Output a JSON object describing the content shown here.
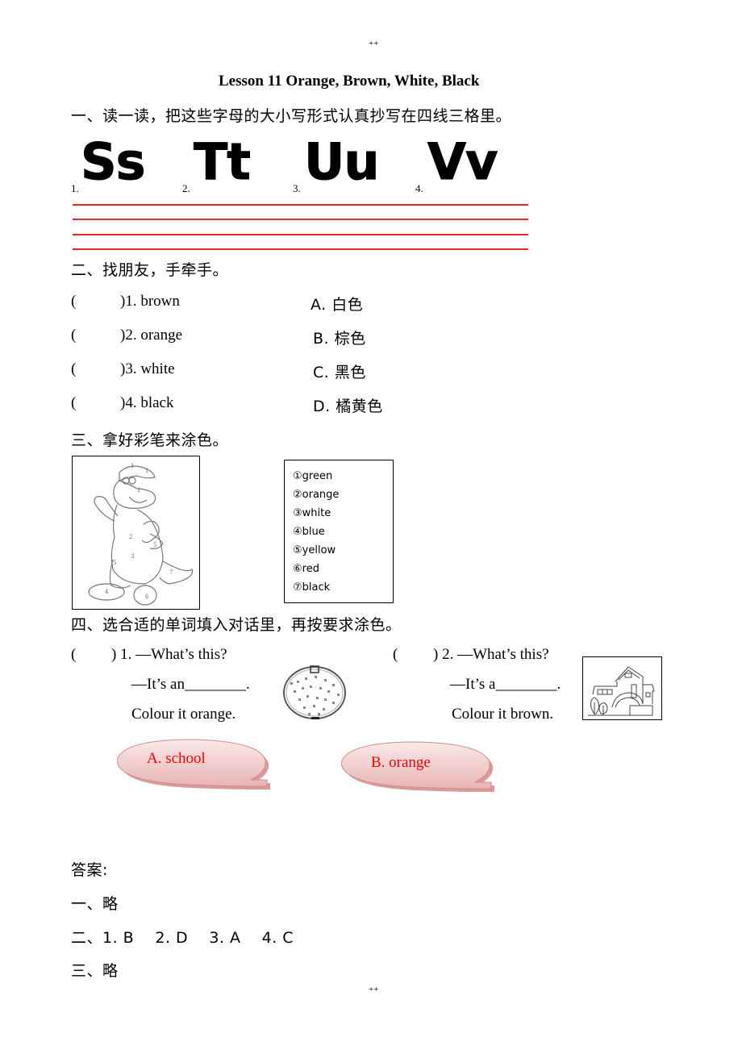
{
  "page": {
    "header_mark": "++",
    "footer_mark": "++",
    "title": "Lesson 11    Orange, Brown, White, Black"
  },
  "section1": {
    "heading": "一、读一读，把这些字母的大小写形式认真抄写在四线三格里。",
    "letters": [
      {
        "num": "1.",
        "pair": "Ss"
      },
      {
        "num": "2.",
        "pair": "Tt"
      },
      {
        "num": "3.",
        "pair": "Uu"
      },
      {
        "num": "4.",
        "pair": "Vv"
      }
    ],
    "line_color": "#e8262b"
  },
  "section2": {
    "heading": "二、找朋友，手牵手。",
    "items": [
      {
        "paren": "(",
        "close": ")1. brown",
        "option": "A.  白色"
      },
      {
        "paren": "(",
        "close": ")2. orange",
        "option": "B.  棕色"
      },
      {
        "paren": "(",
        "close": ")3. white",
        "option": "C.  黑色"
      },
      {
        "paren": "(",
        "close": ")4. black",
        "option": "D.  橘黄色"
      }
    ]
  },
  "section3": {
    "heading": "三、拿好彩笔来涂色。",
    "picture_alt": "dinosaur coloring picture",
    "colors": [
      "①green",
      "②orange",
      "③white",
      "④blue",
      "⑤yellow",
      "⑥red",
      "⑦black"
    ]
  },
  "section4": {
    "heading": "四、选合适的单词填入对话里，再按要求涂色。",
    "q1": {
      "paren": "(",
      "label": ") 1. —What’s this?",
      "answer": "—It’s an________.",
      "instruction": "Colour it orange."
    },
    "q2": {
      "paren": "(",
      "label": ") 2. —What’s this?",
      "answer": "—It’s a________.",
      "instruction": "Colour it brown."
    },
    "options": [
      "A. school",
      "B. orange"
    ],
    "option_color": "#f00000"
  },
  "answers": {
    "heading": "答案:",
    "lines": [
      "一、略",
      "二、1. B    2. D    3. A    4. C",
      "三、略"
    ]
  }
}
